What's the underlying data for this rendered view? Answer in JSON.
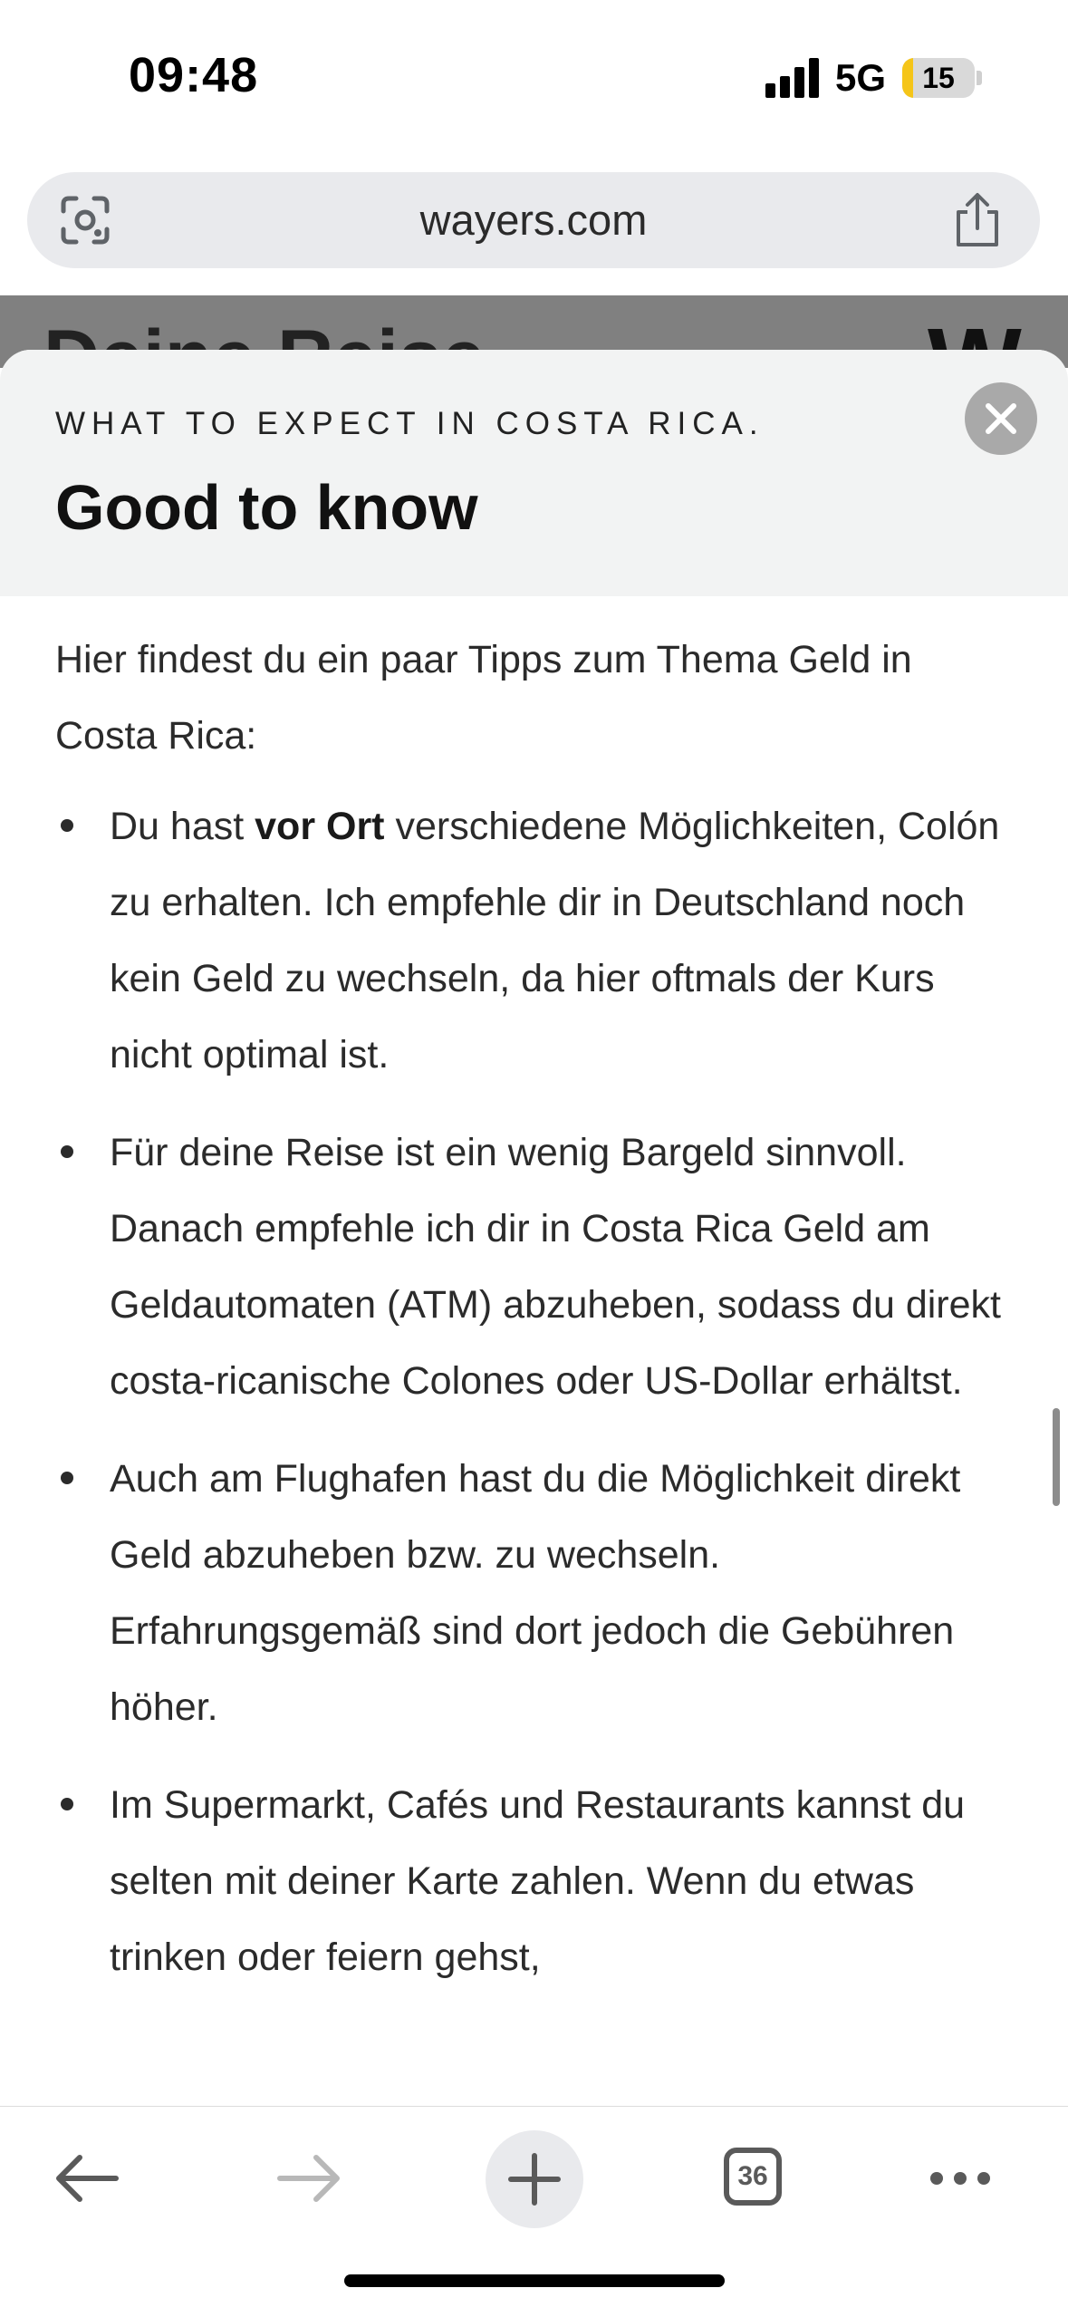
{
  "status_bar": {
    "time": "09:48",
    "network": "5G",
    "battery_level": "15",
    "battery_fraction": 0.15,
    "signal_bars": 4
  },
  "browser": {
    "url": "wayers.com",
    "tab_count": "36",
    "icons": {
      "lens": "visual-search-icon",
      "share": "share-icon",
      "back": "back-arrow-icon",
      "forward": "forward-arrow-icon",
      "new_tab": "plus-icon",
      "tabs": "tabs-icon",
      "more": "more-icon"
    }
  },
  "page_behind": {
    "title": "Deine Reise",
    "logo": "W"
  },
  "sheet": {
    "eyebrow": "WHAT TO EXPECT IN COSTA RICA.",
    "title": "Good to know",
    "intro": "Hier findest du ein paar Tipps zum Thema Geld in Costa Rica:",
    "tips": [
      {
        "before": "Du hast ",
        "bold": "vor Ort",
        "after": " verschiedene Möglichkeiten, Colón zu erhalten. Ich empfehle dir in Deutschland noch kein Geld zu wechseln, da hier oftmals der Kurs nicht optimal ist."
      },
      {
        "before": "Für deine Reise ist ein wenig Bargeld sinnvoll. Danach empfehle ich dir in Costa Rica Geld am Geldautomaten (ATM) abzuheben, sodass du direkt costa-ricanische Colones oder US-Dollar erhältst.",
        "bold": "",
        "after": ""
      },
      {
        "before": "Auch am Flughafen hast du die Möglichkeit direkt Geld abzuheben bzw. zu wechseln. Erfahrungsgemäß sind dort jedoch die Gebühren höher.",
        "bold": "",
        "after": ""
      },
      {
        "before": "Im Supermarkt, Cafés und Restaurants kannst du selten mit deiner Karte zahlen. Wenn du etwas trinken oder feiern gehst,",
        "bold": "",
        "after": ""
      }
    ]
  },
  "colors": {
    "sheet_header_bg": "#f2f3f3",
    "url_bar_bg": "#e9eaed",
    "close_button_bg": "#a9a9a9",
    "battery_fill": "#f5c518"
  }
}
